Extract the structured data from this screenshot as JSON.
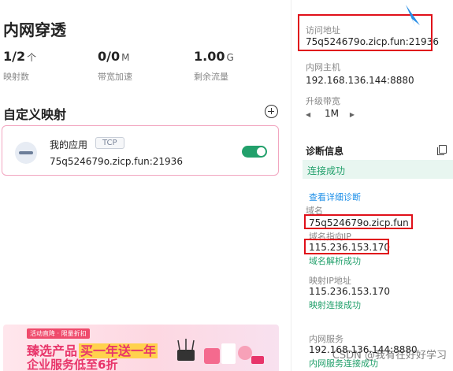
{
  "left": {
    "title": "内网穿透",
    "stats": [
      {
        "value": "1/2",
        "unit": "个",
        "label": "映射数"
      },
      {
        "value": "0/0",
        "unit": "M",
        "label": "带宽加速"
      },
      {
        "value": "1.00",
        "unit": "G",
        "label": "剩余流量"
      }
    ],
    "mappings_title": "自定义映射",
    "mapping_card": {
      "name": "我的应用",
      "protocol": "TCP",
      "address": "75q524679o.zicp.fun:21936",
      "enabled": true
    },
    "banner": {
      "top_tag": "活动直降 · 限量折扣",
      "line1_a": "臻选产品",
      "line1_b": "买一年送一年",
      "line2": "企业服务低至6折"
    }
  },
  "right": {
    "access_label": "访问地址",
    "access_value": "75q524679o.zicp.fun:21936",
    "host_label": "内网主机",
    "host_value": "192.168.136.144:8880",
    "bandwidth_label": "升级带宽",
    "bandwidth_value": "1M",
    "diag_title": "诊断信息",
    "diag_status": "连接成功",
    "detail_link": "查看详细诊断",
    "domain_label": "域名",
    "domain_value": "75q524679o.zicp.fun",
    "domain_ip_label": "域名指向IP",
    "domain_ip_value": "115.236.153.170",
    "domain_resolve_status": "域名解析成功",
    "map_ip_label": "映射IP地址",
    "map_ip_value": "115.236.153.170",
    "map_status": "映射连接成功",
    "service_label": "内网服务",
    "service_value": "192.168.136.144:8880",
    "service_status": "内网服务连接成功"
  },
  "watermark": "CSDN @我有在好好学习",
  "colors": {
    "accent_green": "#22a06b",
    "link_blue": "#1d8fe8",
    "highlight_red": "#e0101a",
    "card_border": "#f2a6c0"
  }
}
